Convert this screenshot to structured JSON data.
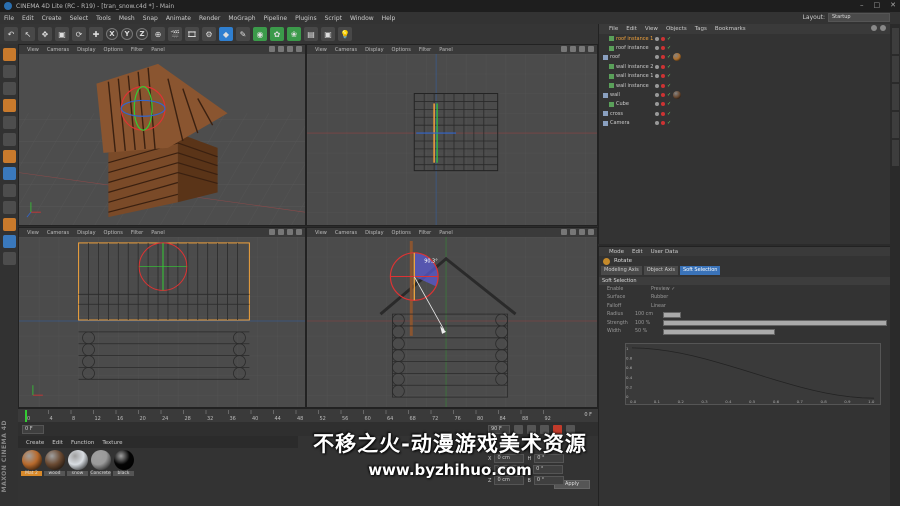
{
  "window": {
    "title": "CINEMA 4D Lite (RC - R19) - [tran_snow.c4d *] - Main",
    "controls": [
      "–",
      "□",
      "✕"
    ]
  },
  "menu": [
    "File",
    "Edit",
    "Create",
    "Select",
    "Tools",
    "Mesh",
    "Snap",
    "Animate",
    "Render",
    "MoGraph",
    "Pipeline",
    "Plugins",
    "Script",
    "Window",
    "Help"
  ],
  "layout": {
    "label": "Layout:",
    "value": "Startup"
  },
  "toolbar": {
    "axis_x": "X",
    "axis_y": "Y",
    "axis_z": "Z"
  },
  "viewport_menu": [
    "View",
    "Cameras",
    "Display",
    "Options",
    "Filter",
    "Panel"
  ],
  "viewport_annotation": "90.3°",
  "timeline": {
    "ticks": [
      "0",
      "4",
      "8",
      "12",
      "16",
      "20",
      "24",
      "28",
      "32",
      "36",
      "40",
      "44",
      "48",
      "52",
      "56",
      "60",
      "64",
      "68",
      "72",
      "76",
      "80",
      "84",
      "88",
      "92"
    ],
    "end_frame": "0 F",
    "start_field": "0 F",
    "end_field": "90 F"
  },
  "materials": {
    "menu": [
      "Create",
      "Edit",
      "Function",
      "Texture"
    ],
    "items": [
      {
        "label": "Mat 2",
        "color": "#b86a2c"
      },
      {
        "label": "wood",
        "color": "#6a4a32"
      },
      {
        "label": "snow",
        "color": "#d8dde2"
      },
      {
        "label": "Concrete",
        "color": "#9a9a9a"
      },
      {
        "label": "black",
        "color": "#050505"
      }
    ]
  },
  "coordinates": {
    "rows": [
      {
        "axis": "X",
        "value": "0 cm",
        "rot": "H",
        "rot_value": "0 °"
      },
      {
        "axis": "Y",
        "value": "0 cm",
        "rot": "P",
        "rot_value": "0 °"
      },
      {
        "axis": "Z",
        "value": "0 cm",
        "rot": "B",
        "rot_value": "0 °"
      }
    ],
    "apply": "Apply"
  },
  "object_manager": {
    "menu": [
      "File",
      "Edit",
      "View",
      "Objects",
      "Tags",
      "Bookmarks"
    ],
    "rows": [
      {
        "name": "roof instance 1",
        "indent": 1,
        "selected": true,
        "tag": ""
      },
      {
        "name": "roof instance",
        "indent": 1,
        "selected": false,
        "tag": ""
      },
      {
        "name": "roof",
        "indent": 0,
        "selected": false,
        "tag": "#b0702c"
      },
      {
        "name": "wall instance 2",
        "indent": 1,
        "selected": false,
        "tag": ""
      },
      {
        "name": "wall instance 1",
        "indent": 1,
        "selected": false,
        "tag": ""
      },
      {
        "name": "wall instance",
        "indent": 1,
        "selected": false,
        "tag": ""
      },
      {
        "name": "wall",
        "indent": 0,
        "selected": false,
        "tag": "#6a4a32"
      },
      {
        "name": "Cube",
        "indent": 1,
        "selected": false,
        "tag": ""
      },
      {
        "name": "cross",
        "indent": 0,
        "selected": false,
        "tag": ""
      },
      {
        "name": "Camera",
        "indent": 0,
        "selected": false,
        "tag": ""
      }
    ]
  },
  "attribute_manager": {
    "menu": [
      "Mode",
      "Edit",
      "User Data"
    ],
    "title": "Rotate",
    "tabs": [
      {
        "label": "Modeling Axis",
        "active": false
      },
      {
        "label": "Object Axis",
        "active": false
      },
      {
        "label": "Soft Selection",
        "active": true
      }
    ],
    "section": "Soft Selection",
    "rows": [
      {
        "label": "Enable",
        "extra": "Preview ✓"
      },
      {
        "label": "Surface",
        "extra": "Rubber"
      },
      {
        "label": "Falloff",
        "extra": "Linear"
      },
      {
        "label": "Radius",
        "value": "100 cm"
      },
      {
        "label": "Strength",
        "value": "100 %"
      },
      {
        "label": "Width",
        "value": "50 %"
      }
    ],
    "graph_y": [
      "1",
      "0.8",
      "0.6",
      "0.4",
      "0.2",
      "0"
    ],
    "graph_x": [
      "0.0",
      "0.1",
      "0.2",
      "0.3",
      "0.4",
      "0.5",
      "0.6",
      "0.7",
      "0.8",
      "0.9",
      "1.0"
    ]
  },
  "watermark": {
    "line1": "不移之火-动漫游戏美术资源",
    "line2": "www.byzhihuo.com"
  }
}
